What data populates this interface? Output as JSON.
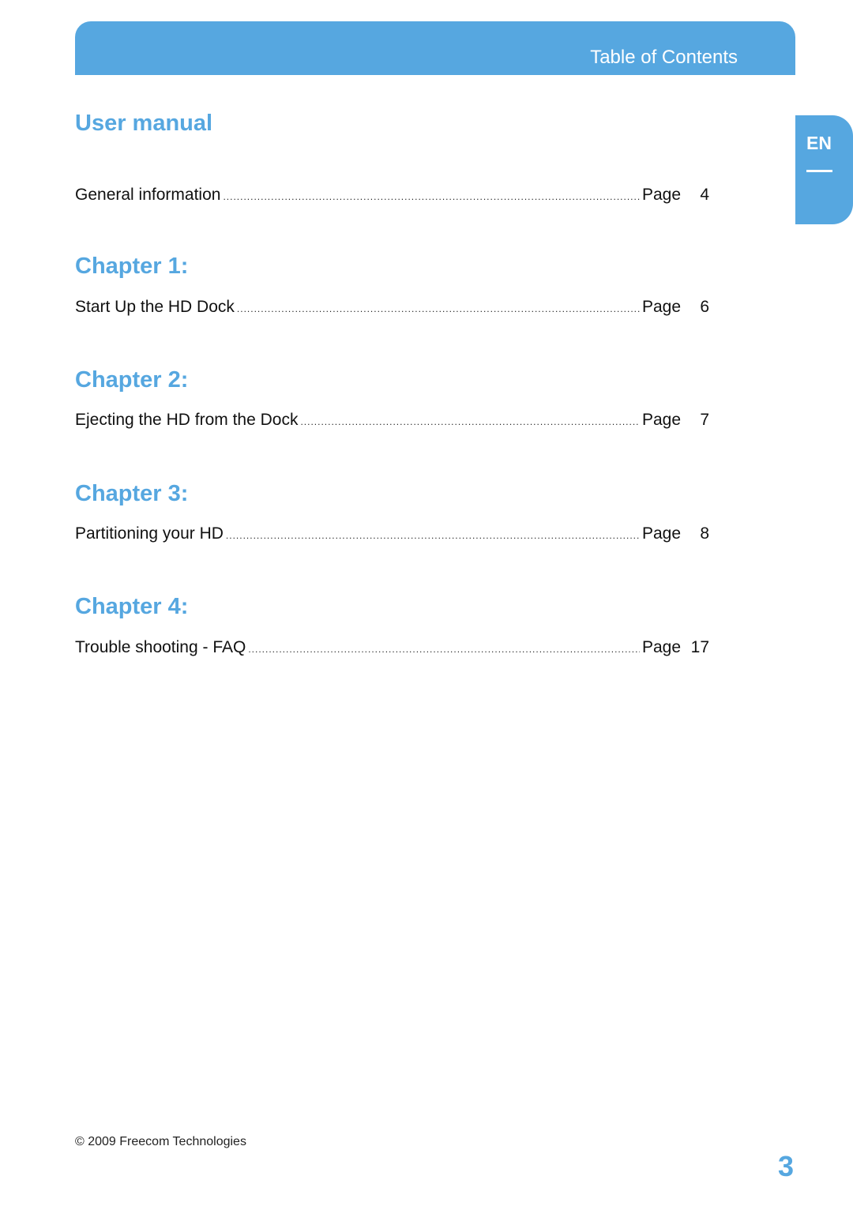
{
  "header": {
    "title": "Table of Contents"
  },
  "language_tab": {
    "label": "EN"
  },
  "sections": [
    {
      "heading": "User manual",
      "entries": [
        {
          "title": "General information",
          "page_label": "Page",
          "page": "4"
        }
      ]
    },
    {
      "heading": "Chapter 1:",
      "entries": [
        {
          "title": "Start Up the HD Dock",
          "page_label": "Page",
          "page": "6"
        }
      ]
    },
    {
      "heading": "Chapter 2:",
      "entries": [
        {
          "title": "Ejecting the HD from the Dock",
          "page_label": "Page",
          "page": "7"
        }
      ]
    },
    {
      "heading": "Chapter 3:",
      "entries": [
        {
          "title": "Partitioning your HD",
          "page_label": "Page",
          "page": "8"
        }
      ]
    },
    {
      "heading": "Chapter 4:",
      "entries": [
        {
          "title": "Trouble shooting - FAQ",
          "page_label": "Page",
          "page": "17"
        }
      ]
    }
  ],
  "footer": {
    "copyright": "© 2009 Freecom Technologies"
  },
  "page_number": "3",
  "colors": {
    "accent": "#56a7e0"
  }
}
